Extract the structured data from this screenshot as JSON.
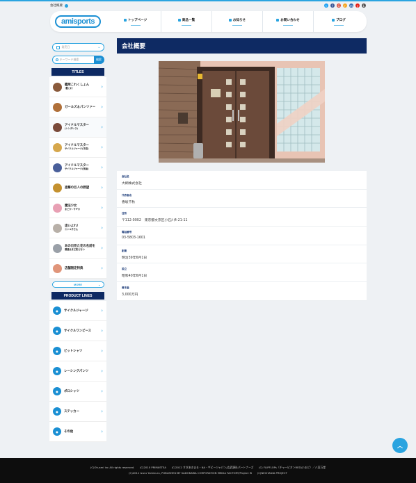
{
  "breadcrumb": "会社概要",
  "social": [
    {
      "icon": "twitter-icon",
      "glyph": "t",
      "color": "#1da1f2"
    },
    {
      "icon": "facebook-icon",
      "glyph": "f",
      "color": "#3b5998"
    },
    {
      "icon": "google-plus-icon",
      "glyph": "G",
      "color": "#dd4b39"
    },
    {
      "icon": "rss-icon",
      "glyph": "r",
      "color": "#f5a623"
    },
    {
      "icon": "mixi-icon",
      "glyph": "m",
      "color": "#3a6fb0"
    },
    {
      "icon": "youtube-icon",
      "glyph": "y",
      "color": "#e62117"
    },
    {
      "icon": "line-icon",
      "glyph": "L",
      "color": "#555555"
    }
  ],
  "logo": "amisports",
  "nav": [
    {
      "label": "トップページ",
      "icon": "home-icon"
    },
    {
      "label": "商品一覧",
      "icon": "cart-icon"
    },
    {
      "label": "お知らせ",
      "icon": "info-icon"
    },
    {
      "label": "お問い合わせ",
      "icon": "mail-icon"
    },
    {
      "label": "ブログ",
      "icon": "pen-icon"
    }
  ],
  "sidebar": {
    "date_placeholder": "発売日",
    "search_placeholder": "キーワード検索",
    "search_button": "検索",
    "titles_heading": "TITLES",
    "titles": [
      {
        "name": "艦隊これくしょん",
        "sub": "-艦これ-",
        "color": "#8a5a3b"
      },
      {
        "name": "ガールズ＆パンツァー",
        "sub": "",
        "color": "#b0703a"
      },
      {
        "name": "アイドルマスター",
        "sub": "(シンデレラ)",
        "color": "#7a4a3a"
      },
      {
        "name": "アイドルマスター",
        "sub": "サイクルジャージ(手袋)",
        "color": "#d6a74c"
      },
      {
        "name": "アイドルマスター",
        "sub": "サイクルジャージ(長袖)",
        "color": "#4a5f9a"
      },
      {
        "name": "進撃の巨人の野望",
        "sub": "",
        "color": "#c4912f"
      },
      {
        "name": "魔法少女",
        "sub": "まどか☆マギカ",
        "color": "#e8a0b4"
      },
      {
        "name": "這いよれ！",
        "sub": "ニャル子さん",
        "color": "#b8b0a8"
      },
      {
        "name": "あの日見た花の名前を",
        "sub": "僕達はまだ知らない",
        "color": "#9aa0a8"
      },
      {
        "name": "店舗限定特典",
        "sub": "",
        "color": "#e0957a"
      }
    ],
    "more_label": "MORE",
    "products_heading": "PRODUCT LINES",
    "products": [
      {
        "name": "サイクルジャージ",
        "icon": "jersey-icon"
      },
      {
        "name": "サイクルワンピース",
        "icon": "onepiece-icon"
      },
      {
        "name": "ビットシャツ",
        "icon": "tshirt-icon"
      },
      {
        "name": "レーシングパンツ",
        "icon": "pants-icon"
      },
      {
        "name": "ポロシャツ",
        "icon": "polo-icon"
      },
      {
        "name": "ステッカー",
        "icon": "sticker-icon"
      },
      {
        "name": "その他",
        "icon": "etc-icon"
      }
    ]
  },
  "main": {
    "title": "会社概要",
    "info": [
      {
        "label": "会社名",
        "value": "大網株式会社"
      },
      {
        "label": "代表者名",
        "value": "香坂千秋"
      },
      {
        "label": "住所",
        "value": "〒112-0002　東京都文京区小石川4-21-11"
      },
      {
        "label": "電話番号",
        "value": "03-5803-1601"
      },
      {
        "label": "創業",
        "value": "明治39年6月1日"
      },
      {
        "label": "設立",
        "value": "昭和40年6月1日"
      },
      {
        "label": "資本金",
        "value": "3,000万円"
      }
    ]
  },
  "footer": {
    "line1": "(C)Oh-ami inc All rights reserved.　　(C)2010 PRIMASTEA　　(C)2012 すぎあきまる・NA・ギビージャパン/吉武源社パートナーズ　　(C) FLIPFLOPs（チャーピオンRED)いるど）／八百万堂",
    "line2": "(C)2011 Izuru Yumizuru, PUBLISHED BY KADOKAWA CORPORATION MEDIA FACTORY/Project IS　　(C)NECHANIA PROJECT"
  }
}
